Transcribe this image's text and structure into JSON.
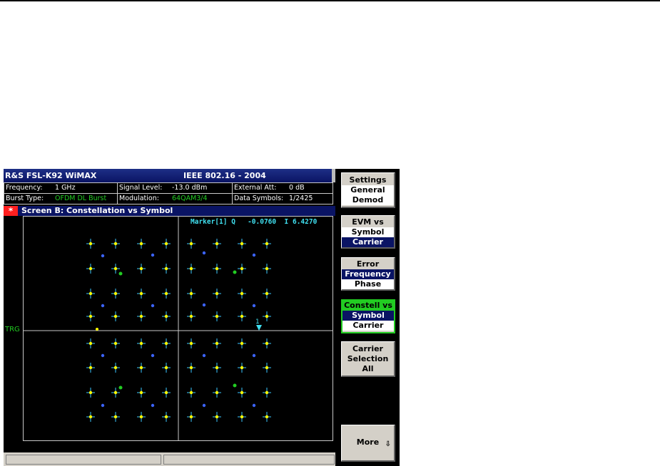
{
  "window": {
    "title": "R&S FSL-K92 WiMAX",
    "standard": "IEEE 802.16 - 2004"
  },
  "info": {
    "frequency_label": "Frequency:",
    "frequency_value": "1 GHz",
    "signal_level_label": "Signal Level:",
    "signal_level_value": "-13.0 dBm",
    "external_att_label": "External Att:",
    "external_att_value": "0 dB",
    "burst_type_label": "Burst Type:",
    "burst_type_value": "OFDM DL Burst",
    "modulation_label": "Modulation:",
    "modulation_value": "64QAM3/4",
    "data_symbols_label": "Data Symbols:",
    "data_symbols_value": "1/2425"
  },
  "screen": {
    "star": "*",
    "title": "Screen B: Constellation vs Symbol",
    "trigger_label": "TRG",
    "marker_readout": "Marker[1] Q   -0.0760  I 6.4270",
    "marker_number": "1"
  },
  "colors": {
    "ideal_point": "#ffff00",
    "cross": "#3cc8ff",
    "measured_blue": "#3c64ff",
    "measured_green": "#22cc22",
    "marker": "#40e0f0"
  },
  "softkeys": {
    "settings": {
      "line1": "Settings",
      "line2": "General",
      "line3": "Demod"
    },
    "evm": {
      "line1": "EVM vs",
      "line2": "Symbol",
      "line3": "Carrier"
    },
    "error": {
      "line1": "Error",
      "line2": "Frequency",
      "line3": "Phase"
    },
    "constell": {
      "line1": "Constell vs",
      "line2": "Symbol",
      "line3": "Carrier"
    },
    "carrier": {
      "line1": "Carrier",
      "line2": "Selection",
      "line3": "All"
    },
    "more": {
      "label": "More",
      "arrow_icon": "down-arrow-icon",
      "arrow": "⇩"
    }
  }
}
